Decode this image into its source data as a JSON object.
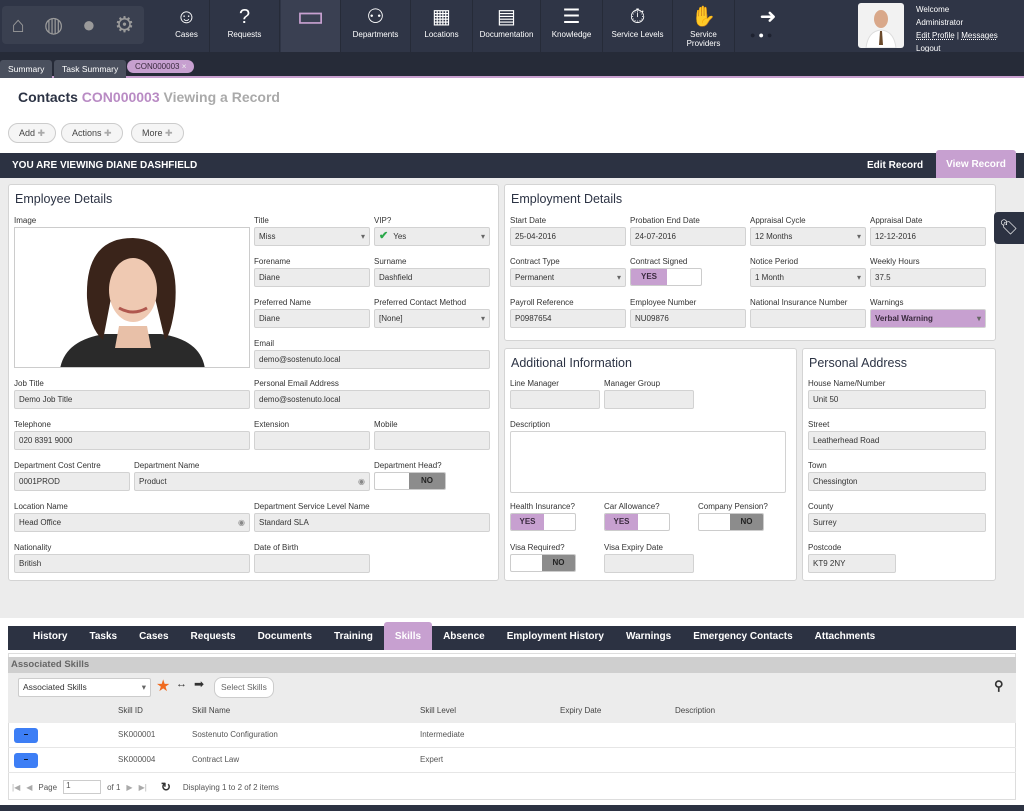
{
  "nav": {
    "items": [
      {
        "label": "Cases",
        "icon": "headset-icon"
      },
      {
        "label": "Requests",
        "icon": "question-bubble-icon"
      },
      {
        "label": "",
        "icon": "contact-card-icon"
      },
      {
        "label": "Departments",
        "icon": "people-icon"
      },
      {
        "label": "Locations",
        "icon": "building-icon"
      },
      {
        "label": "Documentation",
        "icon": "briefcase-icon"
      },
      {
        "label": "Knowledge",
        "icon": "books-icon"
      },
      {
        "label": "Service Levels",
        "icon": "stopwatch-icon"
      },
      {
        "label": "Service Providers",
        "icon": "handshake-icon"
      }
    ],
    "user": {
      "welcome": "Welcome",
      "name": "Administrator",
      "edit_profile": "Edit Profile",
      "sep": "|",
      "messages": "Messages",
      "logout": "Logout"
    }
  },
  "tabs": {
    "summary": "Summary",
    "task_summary": "Task Summary",
    "record": "CON000003"
  },
  "header": {
    "module": "Contacts",
    "id": "CON000003",
    "mode": "Viewing a Record"
  },
  "toolbar": {
    "add": "Add",
    "actions": "Actions",
    "more": "More"
  },
  "viewbar": {
    "text": "YOU ARE VIEWING DIANE DASHFIELD",
    "edit": "Edit Record",
    "view": "View Record"
  },
  "employee": {
    "title": "Employee Details",
    "image_label": "Image",
    "fields": [
      {
        "label": "Title",
        "value": "Miss",
        "type": "select"
      },
      {
        "label": "VIP?",
        "value": "Yes",
        "type": "check"
      },
      {
        "label": "Forename",
        "value": "Diane"
      },
      {
        "label": "Surname",
        "value": "Dashfield"
      },
      {
        "label": "Preferred Name",
        "value": "Diane"
      },
      {
        "label": "Preferred Contact Method",
        "value": "[None]",
        "type": "select"
      },
      {
        "label": "Email",
        "value": "demo@sostenuto.local"
      },
      {
        "label": "Job Title",
        "value": "Demo Job Title"
      },
      {
        "label": "Personal Email Address",
        "value": "demo@sostenuto.local"
      },
      {
        "label": "Telephone",
        "value": "020 8391 9000"
      },
      {
        "label": "Extension",
        "value": ""
      },
      {
        "label": "Mobile",
        "value": ""
      },
      {
        "label": "Department Cost Centre",
        "value": "0001PROD"
      },
      {
        "label": "Department Name",
        "value": "Product",
        "type": "eye"
      },
      {
        "label": "Department Head?",
        "value": "NO",
        "type": "toggle"
      },
      {
        "label": "Location Name",
        "value": "Head Office",
        "type": "eye"
      },
      {
        "label": "Department Service Level Name",
        "value": "Standard SLA"
      },
      {
        "label": "Nationality",
        "value": "British"
      },
      {
        "label": "Date of Birth",
        "value": ""
      }
    ]
  },
  "employment": {
    "title": "Employment Details",
    "fields": [
      {
        "label": "Start Date",
        "value": "25-04-2016"
      },
      {
        "label": "Probation End Date",
        "value": "24-07-2016"
      },
      {
        "label": "Appraisal Cycle",
        "value": "12 Months",
        "type": "select"
      },
      {
        "label": "Appraisal Date",
        "value": "12-12-2016"
      },
      {
        "label": "Contract Type",
        "value": "Permanent",
        "type": "select"
      },
      {
        "label": "Contract Signed",
        "value": "YES",
        "type": "toggle"
      },
      {
        "label": "Notice Period",
        "value": "1 Month",
        "type": "select"
      },
      {
        "label": "Weekly Hours",
        "value": "37.5"
      },
      {
        "label": "Payroll Reference",
        "value": "P0987654"
      },
      {
        "label": "Employee Number",
        "value": "NU09876"
      },
      {
        "label": "National Insurance Number",
        "value": ""
      },
      {
        "label": "Warnings",
        "value": "Verbal Warning",
        "type": "warn"
      }
    ]
  },
  "additional": {
    "title": "Additional Information",
    "fields": [
      {
        "label": "Line Manager",
        "value": ""
      },
      {
        "label": "Manager Group",
        "value": ""
      },
      {
        "label": "Description",
        "value": "",
        "type": "area"
      },
      {
        "label": "Health Insurance?",
        "value": "YES",
        "type": "toggle"
      },
      {
        "label": "Car Allowance?",
        "value": "YES",
        "type": "toggle"
      },
      {
        "label": "Company Pension?",
        "value": "NO",
        "type": "toggle"
      },
      {
        "label": "Visa Required?",
        "value": "NO",
        "type": "toggle"
      },
      {
        "label": "Visa Expiry Date",
        "value": ""
      }
    ]
  },
  "address": {
    "title": "Personal Address",
    "fields": [
      {
        "label": "House Name/Number",
        "value": "Unit 50"
      },
      {
        "label": "Street",
        "value": "Leatherhead Road"
      },
      {
        "label": "Town",
        "value": "Chessington"
      },
      {
        "label": "County",
        "value": "Surrey"
      },
      {
        "label": "Postcode",
        "value": "KT9 2NY"
      }
    ]
  },
  "bottom_tabs": [
    "History",
    "Tasks",
    "Cases",
    "Requests",
    "Documents",
    "Training",
    "Skills",
    "Absence",
    "Employment History",
    "Warnings",
    "Emergency Contacts",
    "Attachments"
  ],
  "active_tab": "Skills",
  "skills": {
    "header": "Associated Skills",
    "view_select": "Associated Skills",
    "select_btn": "Select Skills",
    "columns": [
      "Skill ID",
      "Skill Name",
      "Skill Level",
      "Expiry Date",
      "Description"
    ],
    "rows": [
      [
        "SK000001",
        "Sostenuto Configuration",
        "Intermediate",
        "",
        ""
      ],
      [
        "SK000004",
        "Contract Law",
        "Expert",
        "",
        ""
      ]
    ],
    "pager": {
      "page_label": "Page",
      "page": "1",
      "of": "of 1",
      "status": "Displaying 1 to 2 of 2 items"
    }
  },
  "colors": {
    "accent": "#c7a0d0",
    "nav": "#2f3546",
    "remove_button": "#3d7ef5"
  }
}
